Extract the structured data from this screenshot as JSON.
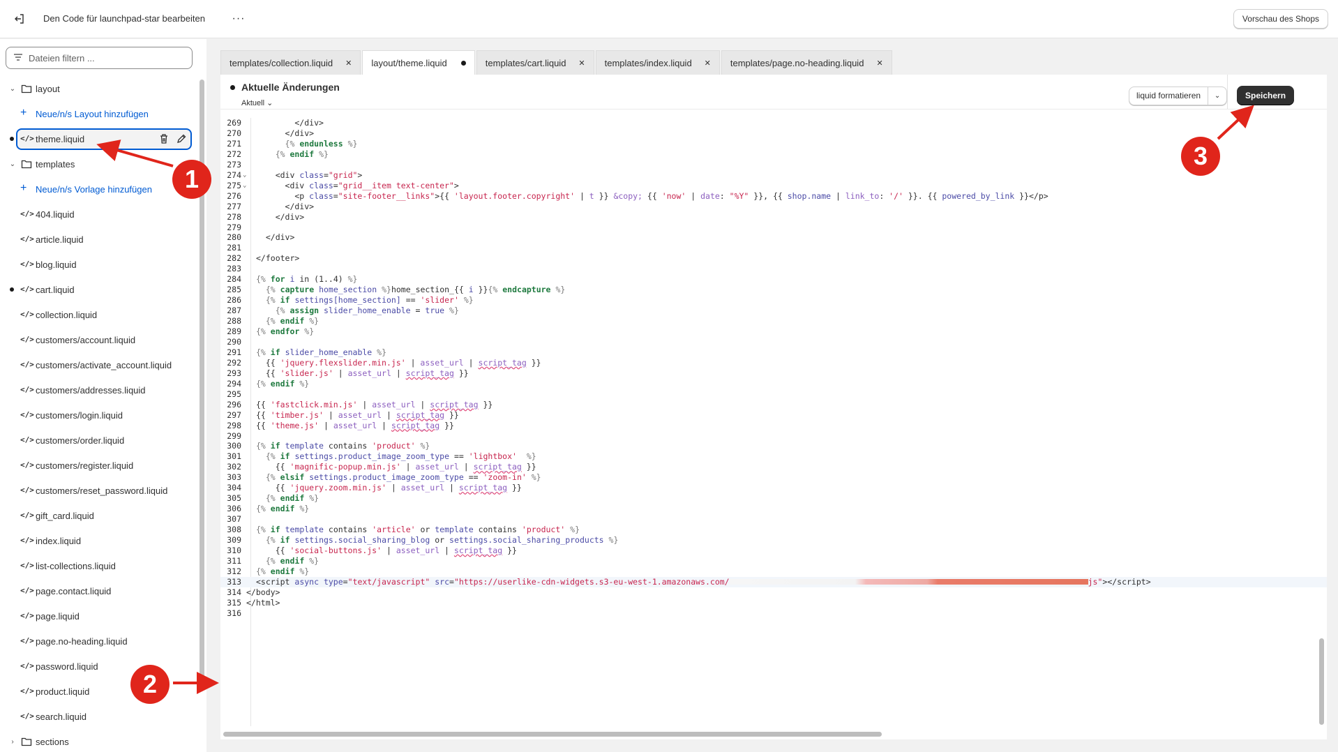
{
  "topbar": {
    "title": "Den Code für launchpad-star bearbeiten",
    "more": "···",
    "preview_label": "Vorschau des Shops"
  },
  "sidebar": {
    "filter_placeholder": "Dateien filtern ...",
    "items": [
      {
        "type": "folder",
        "label": "layout"
      },
      {
        "type": "add",
        "label": "Neue/n/s Layout hinzufügen"
      },
      {
        "type": "file",
        "label": "theme.liquid",
        "active": true,
        "modified": true
      },
      {
        "type": "folder",
        "label": "templates"
      },
      {
        "type": "add",
        "label": "Neue/n/s Vorlage hinzufügen"
      },
      {
        "type": "file",
        "label": "404.liquid"
      },
      {
        "type": "file",
        "label": "article.liquid"
      },
      {
        "type": "file",
        "label": "blog.liquid"
      },
      {
        "type": "file",
        "label": "cart.liquid",
        "modified": true
      },
      {
        "type": "file",
        "label": "collection.liquid"
      },
      {
        "type": "file",
        "label": "customers/account.liquid"
      },
      {
        "type": "file",
        "label": "customers/activate_account.liquid"
      },
      {
        "type": "file",
        "label": "customers/addresses.liquid"
      },
      {
        "type": "file",
        "label": "customers/login.liquid"
      },
      {
        "type": "file",
        "label": "customers/order.liquid"
      },
      {
        "type": "file",
        "label": "customers/register.liquid"
      },
      {
        "type": "file",
        "label": "customers/reset_password.liquid"
      },
      {
        "type": "file",
        "label": "gift_card.liquid"
      },
      {
        "type": "file",
        "label": "index.liquid"
      },
      {
        "type": "file",
        "label": "list-collections.liquid"
      },
      {
        "type": "file",
        "label": "page.contact.liquid"
      },
      {
        "type": "file",
        "label": "page.liquid"
      },
      {
        "type": "file",
        "label": "page.no-heading.liquid"
      },
      {
        "type": "file",
        "label": "password.liquid"
      },
      {
        "type": "file",
        "label": "product.liquid"
      },
      {
        "type": "file",
        "label": "search.liquid"
      },
      {
        "type": "folder-collapsed",
        "label": "sections"
      }
    ]
  },
  "tabs": [
    {
      "prefix": "templates/",
      "name": "collection.liquid",
      "state": "close"
    },
    {
      "prefix": "layout/",
      "name": "theme.liquid",
      "state": "unsaved",
      "active": true
    },
    {
      "prefix": "templates/",
      "name": "cart.liquid",
      "state": "close"
    },
    {
      "prefix": "templates/",
      "name": "index.liquid",
      "state": "close"
    },
    {
      "prefix": "templates/",
      "name": "page.no-heading.liquid",
      "state": "close"
    }
  ],
  "editor": {
    "changes_title": "Aktuelle Änderungen",
    "version_label": "Aktuell",
    "format_label": "liquid formatieren",
    "save_label": "Speichern",
    "highlighted_line": 313
  },
  "annotations": [
    "1",
    "2",
    "3"
  ],
  "code_lines": [
    {
      "n": 269,
      "h": "        &lt;/div&gt;"
    },
    {
      "n": 270,
      "h": "      &lt;/div&gt;"
    },
    {
      "n": 271,
      "h": "      <span class=\"p\">{%</span> <span class=\"k\">endunless</span> <span class=\"p\">%}</span>"
    },
    {
      "n": 272,
      "h": "    <span class=\"p\">{%</span> <span class=\"k\">endif</span> <span class=\"p\">%}</span>"
    },
    {
      "n": 273,
      "h": ""
    },
    {
      "n": 274,
      "h": "    &lt;div <span class=\"a\">class</span>=<span class=\"s\">\"grid\"</span>&gt;",
      "fold": true
    },
    {
      "n": 275,
      "h": "      &lt;div <span class=\"a\">class</span>=<span class=\"s\">\"grid__item text-center\"</span>&gt;",
      "fold": true
    },
    {
      "n": 276,
      "h": "        &lt;p <span class=\"a\">class</span>=<span class=\"s\">\"site-footer__links\"</span>&gt;{{ <span class=\"s\">'layout.footer.copyright'</span> | <span class=\"f\">t</span> }} <span class=\"f\">&amp;copy;</span> {{ <span class=\"s\">'now'</span> | <span class=\"f\">date</span>: <span class=\"s\">\"%Y\"</span> }}, {{ <span class=\"a\">shop.name</span> | <span class=\"f\">link_to</span>: <span class=\"s\">'/'</span> }}. {{ <span class=\"a\">powered_by_link</span> }}&lt;/p&gt;"
    },
    {
      "n": 277,
      "h": "      &lt;/div&gt;"
    },
    {
      "n": 278,
      "h": "    &lt;/div&gt;"
    },
    {
      "n": 279,
      "h": ""
    },
    {
      "n": 280,
      "h": "  &lt;/div&gt;"
    },
    {
      "n": 281,
      "h": ""
    },
    {
      "n": 282,
      "h": "&lt;/footer&gt;"
    },
    {
      "n": 283,
      "h": ""
    },
    {
      "n": 284,
      "h": "<span class=\"p\">{%</span> <span class=\"k\">for</span> <span class=\"a\">i</span> in (1..4) <span class=\"p\">%}</span>"
    },
    {
      "n": 285,
      "h": "  <span class=\"p\">{%</span> <span class=\"k\">capture</span> <span class=\"a\">home_section</span> <span class=\"p\">%}</span>home_section_{{ <span class=\"a\">i</span> }}<span class=\"p\">{%</span> <span class=\"k\">endcapture</span> <span class=\"p\">%}</span>"
    },
    {
      "n": 286,
      "h": "  <span class=\"p\">{%</span> <span class=\"k\">if</span> <span class=\"a\">settings[home_section]</span> == <span class=\"s\">'slider'</span> <span class=\"p\">%}</span>"
    },
    {
      "n": 287,
      "h": "    <span class=\"p\">{%</span> <span class=\"k\">assign</span> <span class=\"a\">slider_home_enable</span> = <span class=\"a\">true</span> <span class=\"p\">%}</span>"
    },
    {
      "n": 288,
      "h": "  <span class=\"p\">{%</span> <span class=\"k\">endif</span> <span class=\"p\">%}</span>"
    },
    {
      "n": 289,
      "h": "<span class=\"p\">{%</span> <span class=\"k\">endfor</span> <span class=\"p\">%}</span>"
    },
    {
      "n": 290,
      "h": ""
    },
    {
      "n": 291,
      "h": "<span class=\"p\">{%</span> <span class=\"k\">if</span> <span class=\"a\">slider_home_enable</span> <span class=\"p\">%}</span>"
    },
    {
      "n": 292,
      "h": "  {{ <span class=\"s\">'jquery.flexslider.min.js'</span> | <span class=\"f\">asset_url</span> | <span class=\"u\">script_tag</span> }}"
    },
    {
      "n": 293,
      "h": "  {{ <span class=\"s\">'slider.js'</span> | <span class=\"f\">asset_url</span> | <span class=\"u\">script_tag</span> }}"
    },
    {
      "n": 294,
      "h": "<span class=\"p\">{%</span> <span class=\"k\">endif</span> <span class=\"p\">%}</span>"
    },
    {
      "n": 295,
      "h": ""
    },
    {
      "n": 296,
      "h": "{{ <span class=\"s\">'fastclick.min.js'</span> | <span class=\"f\">asset_url</span> | <span class=\"u\">script_tag</span> }}"
    },
    {
      "n": 297,
      "h": "{{ <span class=\"s\">'timber.js'</span> | <span class=\"f\">asset_url</span> | <span class=\"u\">script_tag</span> }}"
    },
    {
      "n": 298,
      "h": "{{ <span class=\"s\">'theme.js'</span> | <span class=\"f\">asset_url</span> | <span class=\"u\">script_tag</span> }}"
    },
    {
      "n": 299,
      "h": ""
    },
    {
      "n": 300,
      "h": "<span class=\"p\">{%</span> <span class=\"k\">if</span> <span class=\"a\">template</span> contains <span class=\"s\">'product'</span> <span class=\"p\">%}</span>"
    },
    {
      "n": 301,
      "h": "  <span class=\"p\">{%</span> <span class=\"k\">if</span> <span class=\"a\">settings.product_image_zoom_type</span> == <span class=\"s\">'lightbox'</span>  <span class=\"p\">%}</span>"
    },
    {
      "n": 302,
      "h": "    {{ <span class=\"s\">'magnific-popup.min.js'</span> | <span class=\"f\">asset_url</span> | <span class=\"u\">script_tag</span> }}"
    },
    {
      "n": 303,
      "h": "  <span class=\"p\">{%</span> <span class=\"k\">elsif</span> <span class=\"a\">settings.product_image_zoom_type</span> == <span class=\"s\">'zoom-in'</span> <span class=\"p\">%}</span>"
    },
    {
      "n": 304,
      "h": "    {{ <span class=\"s\">'jquery.zoom.min.js'</span> | <span class=\"f\">asset_url</span> | <span class=\"u\">script_tag</span> }}"
    },
    {
      "n": 305,
      "h": "  <span class=\"p\">{%</span> <span class=\"k\">endif</span> <span class=\"p\">%}</span>"
    },
    {
      "n": 306,
      "h": "<span class=\"p\">{%</span> <span class=\"k\">endif</span> <span class=\"p\">%}</span>"
    },
    {
      "n": 307,
      "h": ""
    },
    {
      "n": 308,
      "h": "<span class=\"p\">{%</span> <span class=\"k\">if</span> <span class=\"a\">template</span> contains <span class=\"s\">'article'</span> or <span class=\"a\">template</span> contains <span class=\"s\">'product'</span> <span class=\"p\">%}</span>"
    },
    {
      "n": 309,
      "h": "  <span class=\"p\">{%</span> <span class=\"k\">if</span> <span class=\"a\">settings.social_sharing_blog</span> or <span class=\"a\">settings.social_sharing_products</span> <span class=\"p\">%}</span>"
    },
    {
      "n": 310,
      "h": "    {{ <span class=\"s\">'social-buttons.js'</span> | <span class=\"f\">asset_url</span> | <span class=\"u\">script_tag</span> }}"
    },
    {
      "n": 311,
      "h": "  <span class=\"p\">{%</span> <span class=\"k\">endif</span> <span class=\"p\">%}</span>"
    },
    {
      "n": 312,
      "h": "<span class=\"p\">{%</span> <span class=\"k\">endif</span> <span class=\"p\">%}</span>"
    },
    {
      "n": 313,
      "h": "&lt;script <span class=\"a\">async</span> <span class=\"a\">type</span>=<span class=\"s\">\"text/javascript\"</span> <span class=\"a\">src</span>=<span class=\"s\">\"https://userlike-cdn-widgets.s3-eu-west-1.amazonaws.com/<span class=\"redact\"></span>js\"</span>&gt;&lt;/script&gt;"
    },
    {
      "n": 314,
      "h": "&lt;/body&gt;",
      "outdent": true
    },
    {
      "n": 315,
      "h": "&lt;/html&gt;",
      "outdent": true
    },
    {
      "n": 316,
      "h": ""
    }
  ]
}
